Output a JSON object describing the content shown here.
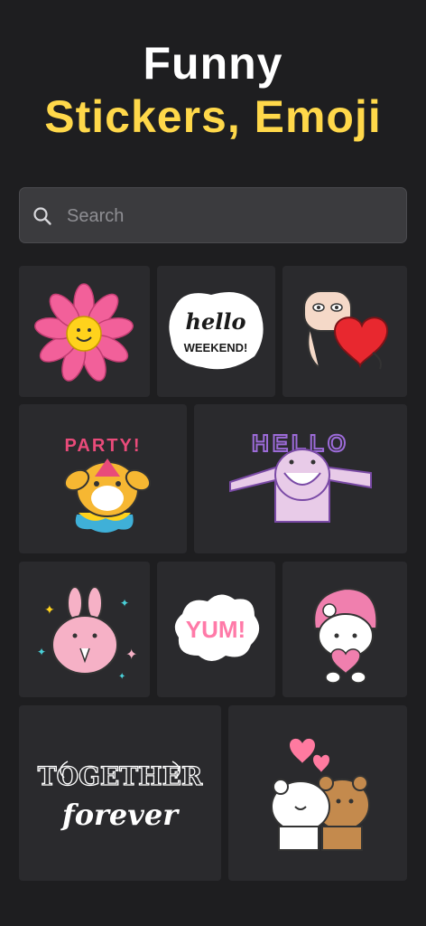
{
  "header": {
    "line1": "Funny",
    "line2": "Stickers, Emoji"
  },
  "search": {
    "placeholder": "Search"
  },
  "stickers": [
    {
      "name": "flower"
    },
    {
      "name": "hello-weekend",
      "text_lines": [
        "hello",
        "WEEKEND!"
      ]
    },
    {
      "name": "heart-hug"
    },
    {
      "name": "party-dog",
      "text": "PARTY!"
    },
    {
      "name": "hello-monster",
      "text": "HELLO"
    },
    {
      "name": "bunny"
    },
    {
      "name": "yum",
      "text": "YUM!"
    },
    {
      "name": "my-melody"
    },
    {
      "name": "together-forever",
      "text_lines": [
        "TOGETHER",
        "forever"
      ]
    },
    {
      "name": "bears-hug"
    }
  ],
  "colors": {
    "accent": "#ffd84a",
    "background": "#1e1e20",
    "tile": "#2a2a2d"
  }
}
